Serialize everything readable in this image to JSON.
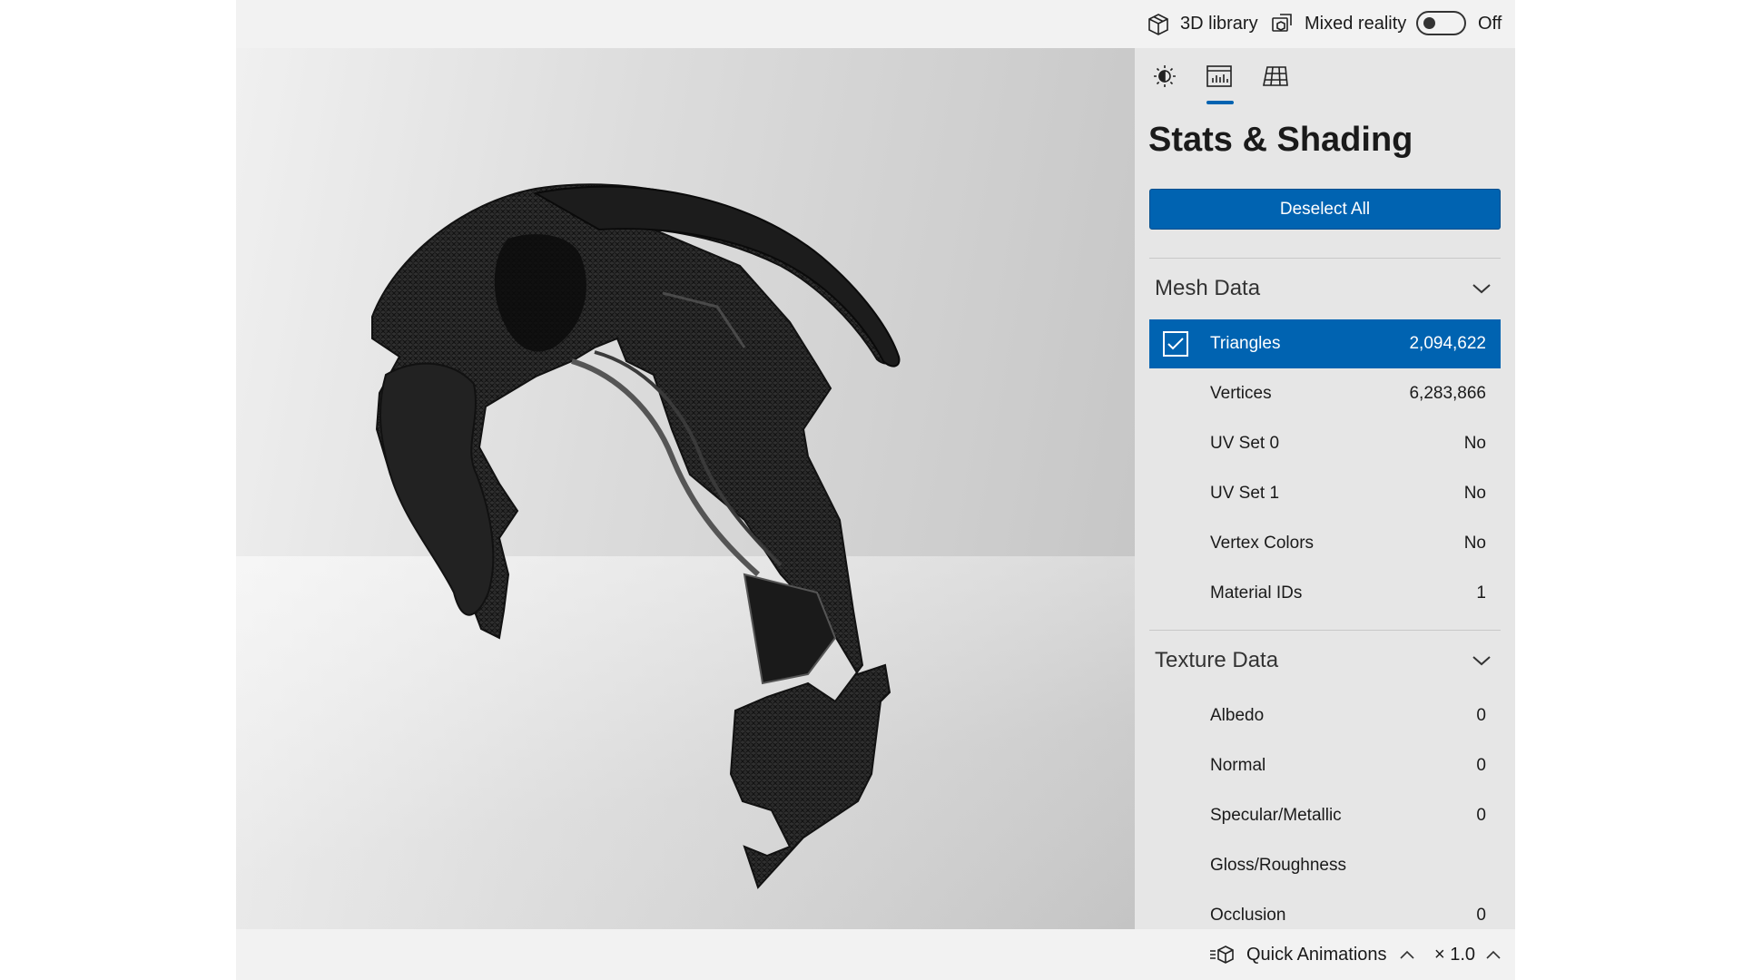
{
  "topbar": {
    "library_label": "3D library",
    "mixed_reality_label": "Mixed reality",
    "toggle_state": "Off"
  },
  "panel": {
    "tabs": [
      {
        "name": "lighting",
        "icon": "sun-icon"
      },
      {
        "name": "stats",
        "icon": "stats-icon",
        "active": true
      },
      {
        "name": "grid",
        "icon": "grid-icon"
      }
    ],
    "title": "Stats & Shading",
    "deselect_label": "Deselect All",
    "mesh_section": {
      "title": "Mesh Data",
      "rows": [
        {
          "label": "Triangles",
          "value": "2,094,622",
          "selected": true
        },
        {
          "label": "Vertices",
          "value": "6,283,866"
        },
        {
          "label": "UV Set 0",
          "value": "No"
        },
        {
          "label": "UV Set 1",
          "value": "No"
        },
        {
          "label": "Vertex Colors",
          "value": "No"
        },
        {
          "label": "Material IDs",
          "value": "1"
        }
      ]
    },
    "texture_section": {
      "title": "Texture Data",
      "rows": [
        {
          "label": "Albedo",
          "value": "0"
        },
        {
          "label": "Normal",
          "value": "0"
        },
        {
          "label": "Specular/Metallic",
          "value": "0"
        },
        {
          "label": "Gloss/Roughness",
          "value": ""
        },
        {
          "label": "Occlusion",
          "value": "0"
        }
      ]
    }
  },
  "bottombar": {
    "quick_animations_label": "Quick Animations",
    "speed_label": "× 1.0"
  },
  "colors": {
    "accent": "#0063b1",
    "panel_bg": "#e6e6e6",
    "chrome_bg": "#f2f2f2"
  }
}
